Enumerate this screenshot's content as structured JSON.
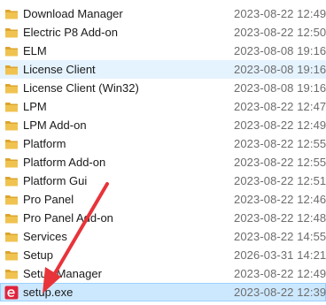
{
  "files": [
    {
      "name": "Download Manager",
      "modified": "2023-08-22 12:49",
      "icon": "folder-icon"
    },
    {
      "name": "Electric P8 Add-on",
      "modified": "2023-08-22 12:50",
      "icon": "folder-icon"
    },
    {
      "name": "ELM",
      "modified": "2023-08-08 19:16",
      "icon": "folder-icon"
    },
    {
      "name": "License Client",
      "modified": "2023-08-08 19:16",
      "icon": "folder-icon",
      "state": "hover"
    },
    {
      "name": "License Client (Win32)",
      "modified": "2023-08-08 19:16",
      "icon": "folder-icon"
    },
    {
      "name": "LPM",
      "modified": "2023-08-22 12:47",
      "icon": "folder-icon"
    },
    {
      "name": "LPM Add-on",
      "modified": "2023-08-22 12:49",
      "icon": "folder-icon"
    },
    {
      "name": "Platform",
      "modified": "2023-08-22 12:55",
      "icon": "folder-icon"
    },
    {
      "name": "Platform Add-on",
      "modified": "2023-08-22 12:55",
      "icon": "folder-icon"
    },
    {
      "name": "Platform Gui",
      "modified": "2023-08-22 12:51",
      "icon": "folder-icon"
    },
    {
      "name": "Pro Panel",
      "modified": "2023-08-22 12:46",
      "icon": "folder-icon"
    },
    {
      "name": "Pro Panel Add-on",
      "modified": "2023-08-22 12:48",
      "icon": "folder-icon"
    },
    {
      "name": "Services",
      "modified": "2023-08-22 14:55",
      "icon": "folder-icon"
    },
    {
      "name": "Setup",
      "modified": "2026-03-31 14:21",
      "icon": "folder-icon"
    },
    {
      "name": "Setup Manager",
      "modified": "2023-08-22 12:49",
      "icon": "folder-icon"
    },
    {
      "name": "setup.exe",
      "modified": "2023-08-22 12:39",
      "icon": "setup-exe-icon",
      "state": "selected"
    }
  ],
  "colors": {
    "folder": "#f0c350",
    "folder_dark": "#dca52e",
    "exe_badge": "#e0233c",
    "annotation_arrow": "#e8333a",
    "hover_bg": "#e5f3ff",
    "selected_bg": "#cce8ff",
    "selected_border": "#99d1ff"
  }
}
